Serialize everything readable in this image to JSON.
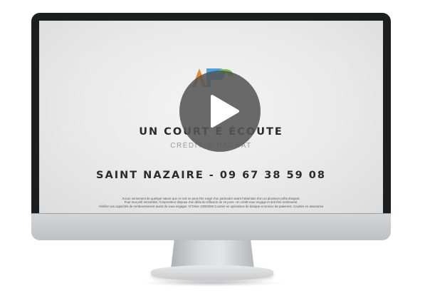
{
  "video": {
    "tagline": "UN COURT            E ÉCOUTE",
    "subline": "CRÉDIT,  A                RACHAT",
    "phone": "SAINT NAZAIRE - 09 67 38 59 08",
    "disclaimer": [
      "Aucun versement de quelque nature que ce soit ne peut être exigé d'un particulier avant l'obtention d'un ou plusieurs prêts d'argent.",
      "Pour tout prêt immobilier, l'emprunteur dispose d'un délai de réflexion de 10 jours. Un crédit vous engage et doit être remboursé.",
      "Vérifiez vos capacités de remboursement avant de vous engager. N°Orias 13003366 Courtier en opérations de banque et service de paiement. Courtier en assurance"
    ]
  },
  "logo": {
    "icon": "company-logo-icon",
    "colors": [
      "#e8892b",
      "#7cc142",
      "#4aa3df"
    ]
  },
  "play_button": {
    "icon": "play-icon",
    "color": "#555555"
  }
}
